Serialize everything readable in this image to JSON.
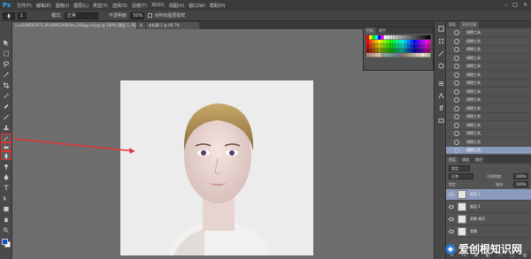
{
  "app": {
    "logo": "Ps"
  },
  "menu": [
    "文件(F)",
    "编辑(E)",
    "图像(I)",
    "图层(L)",
    "类型(Y)",
    "选择(S)",
    "滤镜(T)",
    "3D(D)",
    "视图(V)",
    "窗口(W)",
    "帮助(H)"
  ],
  "window_controls": {
    "min": "–",
    "max": "□",
    "close": "×"
  },
  "options": {
    "brush_size": "1",
    "mode_label": "模式:",
    "mode_value": "正常",
    "opacity_label": "不透明度:",
    "opacity_value": "50%",
    "align_label": "对所有图层取样"
  },
  "tabs": [
    {
      "label": "u=4188591975,3914995246&fm=26&gp=0.jpg @ 100% (图层 1, RGB/8)",
      "active": true
    },
    {
      "label": "Δ",
      "active": false
    },
    {
      "label": "未标题-1 @ 66.7%",
      "active": false
    }
  ],
  "swatches": {
    "tab_swatches": "色板",
    "tab_color": "颜色"
  },
  "history": {
    "tab_layers": "图层",
    "tab_history": "历史记录",
    "items": [
      "模糊工具",
      "模糊工具",
      "模糊工具",
      "模糊工具",
      "模糊工具",
      "模糊工具",
      "模糊工具",
      "模糊工具",
      "模糊工具",
      "模糊工具",
      "模糊工具",
      "模糊工具",
      "模糊工具",
      "模糊工具",
      "模糊工具"
    ],
    "selected_index": 14
  },
  "layers_panel": {
    "tab_layers": "图层",
    "tab_channels": "通道",
    "tab_paths": "路径",
    "kind_filter": "类型",
    "blend_mode": "正常",
    "opacity_label": "不透明度:",
    "opacity_value": "100%",
    "lock_label": "锁定:",
    "fill_label": "填充:",
    "fill_value": "100%",
    "layers": [
      {
        "name": "图层 2",
        "selected": true
      },
      {
        "name": "图层 1",
        "selected": false
      },
      {
        "name": "背景 拷贝",
        "selected": false
      },
      {
        "name": "背景",
        "selected": false
      }
    ]
  },
  "watermark": {
    "text": "爱创根知识网"
  },
  "colors": {
    "accent_selected": "#8a9bbd",
    "highlight_red": "#e63131",
    "foreground": "#0a4fd6",
    "background": "#ffffff"
  }
}
